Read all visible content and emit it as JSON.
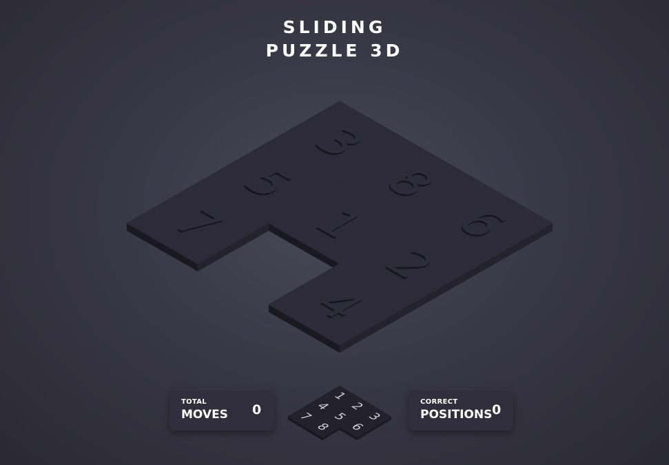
{
  "title": {
    "line1": "SLIDING",
    "line2": "PUZZLE 3D"
  },
  "board": {
    "grid": [
      [
        3,
        8,
        6
      ],
      [
        5,
        1,
        2
      ],
      [
        7,
        null,
        4
      ]
    ],
    "tile_color": "#2c2b37",
    "side_color": "#1f1e28"
  },
  "target_preview": {
    "grid": [
      [
        1,
        2,
        3
      ],
      [
        4,
        5,
        6
      ],
      [
        7,
        8,
        null
      ]
    ]
  },
  "stats": {
    "moves": {
      "small_label": "TOTAL",
      "label": "MOVES",
      "value": "0"
    },
    "positions": {
      "small_label": "CORRECT",
      "label": "POSITIONS",
      "value": "0"
    }
  }
}
